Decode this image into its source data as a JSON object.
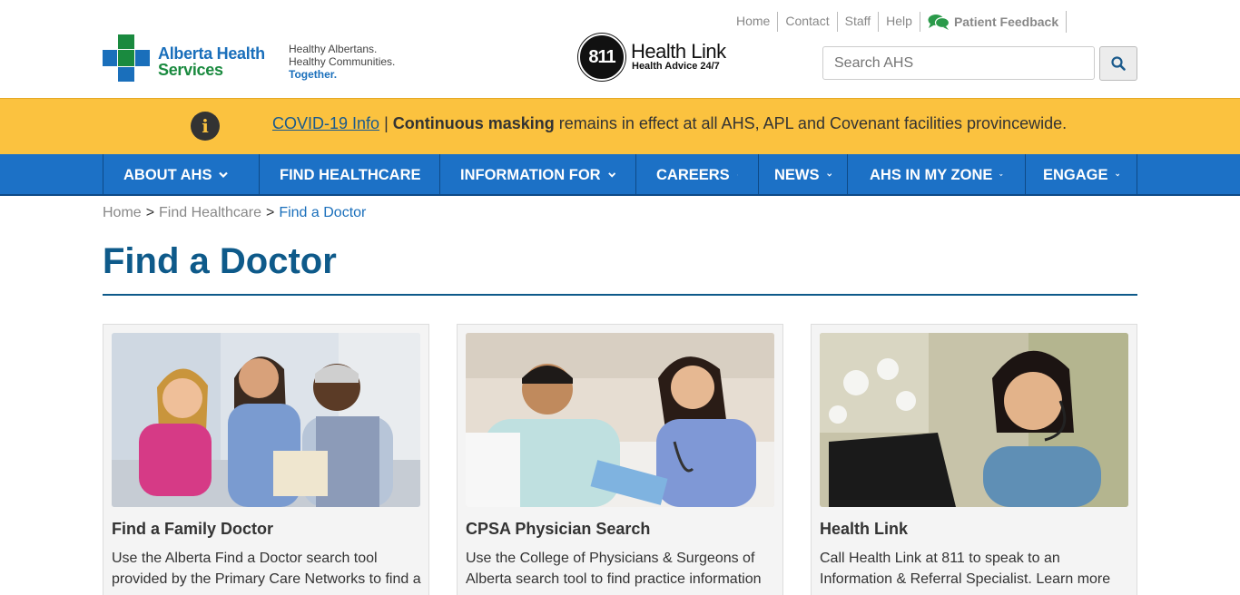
{
  "header": {
    "logo_line1": "Alberta Health",
    "logo_line2": "Services",
    "tagline": [
      "Healthy Albertans.",
      "Healthy Communities.",
      "Together."
    ],
    "healthlink_number": "811",
    "healthlink_title": "Health Link",
    "healthlink_sub": "Health Advice 24/7",
    "top_links": [
      "Home",
      "Contact",
      "Staff",
      "Help"
    ],
    "feedback": "Patient Feedback",
    "search_placeholder": "Search AHS"
  },
  "alert": {
    "link": "COVID-19 Info",
    "divider": "|",
    "strong": "Continuous masking",
    "rest": "remains in effect at all AHS, APL and Covenant facilities provincewide."
  },
  "nav": {
    "items": [
      "ABOUT AHS",
      "FIND HEALTHCARE",
      "INFORMATION FOR",
      "CAREERS",
      "NEWS",
      "AHS IN MY ZONE",
      "ENGAGE"
    ]
  },
  "breadcrumb": [
    "Home",
    "Find Healthcare",
    "Find a Doctor"
  ],
  "page_title": "Find a Doctor",
  "cards": [
    {
      "title": "Find a Family Doctor",
      "body": "Use the Alberta Find a Doctor search tool provided by the Primary Care Networks to find a"
    },
    {
      "title": "CPSA Physician Search",
      "body": "Use the College of Physicians & Surgeons of Alberta search tool to find practice information"
    },
    {
      "title": "Health Link",
      "body": "Call Health Link at 811 to speak to an Information & Referral Specialist. Learn more"
    }
  ],
  "colors": {
    "brand_blue": "#1c71c6",
    "brand_green": "#1a8a3f",
    "alert_yellow": "#fbc23f",
    "title_blue": "#0e5a8a"
  }
}
